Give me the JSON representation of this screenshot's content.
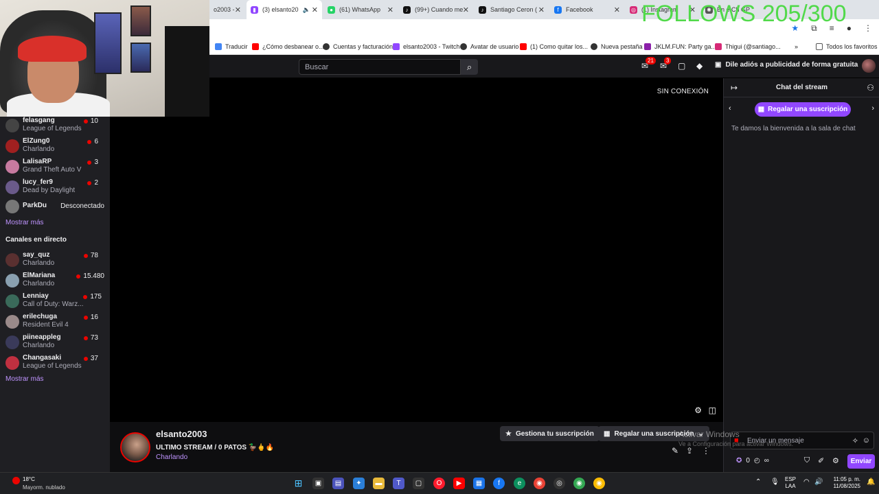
{
  "overlay_text": "FOLLOWS 205/300",
  "browser": {
    "tabs": [
      {
        "label": "o2003 -",
        "icon": "twitch"
      },
      {
        "label": "(3) elsanto20",
        "icon": "twitch"
      },
      {
        "label": "(61) WhatsApp",
        "icon": "whatsapp"
      },
      {
        "label": "(99+) Cuando me",
        "icon": "tiktok"
      },
      {
        "label": "Santiago Ceron (",
        "icon": "tiktok"
      },
      {
        "label": "Facebook",
        "icon": "facebook"
      },
      {
        "label": "(1) Instagram",
        "icon": "instagram"
      },
      {
        "label": "En   e Ch   GP",
        "icon": "chatgpt"
      }
    ],
    "bookmarks": [
      {
        "label": "Traducir",
        "color": "#4285f4"
      },
      {
        "label": "¿Cómo desbanear o...",
        "color": "#ff0000"
      },
      {
        "label": "Cuentas y facturación",
        "color": "#333333"
      },
      {
        "label": "elsanto2003 - Twitch",
        "color": "#9147ff"
      },
      {
        "label": "Avatar de usuario",
        "color": "#333333"
      },
      {
        "label": "(1) Como quitar los...",
        "color": "#ff0000"
      },
      {
        "label": "Nueva pestaña",
        "color": "#333333"
      },
      {
        "label": "JKLM.FUN: Party ga...",
        "color": "#8b1fa9"
      },
      {
        "label": "Thigui (@santiago...",
        "color": "#d62976"
      },
      {
        "label": "Todos los favoritos",
        "color": "#555555"
      }
    ]
  },
  "twitch_nav": {
    "search_placeholder": "Buscar",
    "notifications_count": "21",
    "inbox_count": "3",
    "ad_free_label": "Dile adiós a publicidad de forma gratuita"
  },
  "sidebar": {
    "followed_channels": [
      {
        "name": "felasgang",
        "game": "League of Legends",
        "viewers": "10",
        "color": "#444444"
      },
      {
        "name": "ElZung0",
        "game": "Charlando",
        "viewers": "6",
        "color": "#a02020"
      },
      {
        "name": "LalisaRP",
        "game": "Grand Theft Auto V",
        "viewers": "3",
        "color": "#c77aa0"
      },
      {
        "name": "lucy_fer9",
        "game": "Dead by Daylight",
        "viewers": "2",
        "color": "#6a5a8a"
      }
    ],
    "offline_channel": {
      "name": "ParkDu",
      "status": "Desconectado",
      "color": "#777777"
    },
    "show_more_1": "Mostrar más",
    "live_section_title": "Canales en directo",
    "live_channels": [
      {
        "name": "say_quz",
        "game": "Charlando",
        "viewers": "78",
        "color": "#5a3030"
      },
      {
        "name": "ElMariana",
        "game": "Charlando",
        "viewers": "15.480",
        "color": "#8aa0b0"
      },
      {
        "name": "Lenniay",
        "game": "Call of Duty: Warz...",
        "viewers": "175",
        "color": "#3a6a5a"
      },
      {
        "name": "erilechuga",
        "game": "Resident Evil 4",
        "viewers": "16",
        "color": "#9a8a8a"
      },
      {
        "name": "piineappleg",
        "game": "Charlando",
        "viewers": "73",
        "color": "#3a3a5a"
      },
      {
        "name": "Changasaki",
        "game": "League of Legends",
        "viewers": "37",
        "color": "#c03040"
      }
    ],
    "show_more_2": "Mostrar más"
  },
  "video": {
    "offline_label": "SIN CONEXIÓN"
  },
  "stream_info": {
    "streamer": "elsanto2003",
    "title": "ULTIMO STREAM / 0 PATOS 🦆🖕🔥",
    "category": "Charlando",
    "manage_sub_label": "Gestiona tu suscripción",
    "gift_sub_label": "Regalar una suscripción"
  },
  "chat": {
    "title": "Chat del stream",
    "gift_pill_label": "Regalar una suscripción",
    "welcome": "Te damos la bienvenida a la sala de chat",
    "input_placeholder": "Enviar un mensaje",
    "points": "0",
    "send_label": "Enviar"
  },
  "windows_watermark": {
    "line1": "Activar Windows",
    "line2": "Ve a Configuración para activar Windows."
  },
  "taskbar": {
    "weather_temp": "18°C",
    "weather_desc": "Mayorm. nublado",
    "lang_line1": "ESP",
    "lang_line2": "LAA",
    "time": "11:05 p. m.",
    "date": "11/08/2025"
  }
}
